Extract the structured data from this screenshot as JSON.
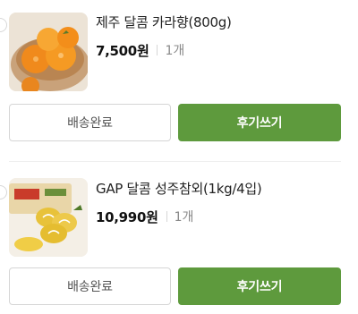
{
  "orders": [
    {
      "name": "제주 달콤 카라향(800g)",
      "price": "7,500원",
      "quantity": "1개",
      "delivered_label": "배송완료",
      "review_label": "후기쓰기"
    },
    {
      "name": "GAP 달콤 성주참외(1kg/4입)",
      "price": "10,990원",
      "quantity": "1개",
      "delivered_label": "배송완료",
      "review_label": "후기쓰기"
    }
  ],
  "colors": {
    "review_button_bg": "#5e9a3d",
    "review_button_text": "#ffffff",
    "delivered_border": "#d5d5d5",
    "price_text": "#111111",
    "qty_text": "#888888"
  }
}
